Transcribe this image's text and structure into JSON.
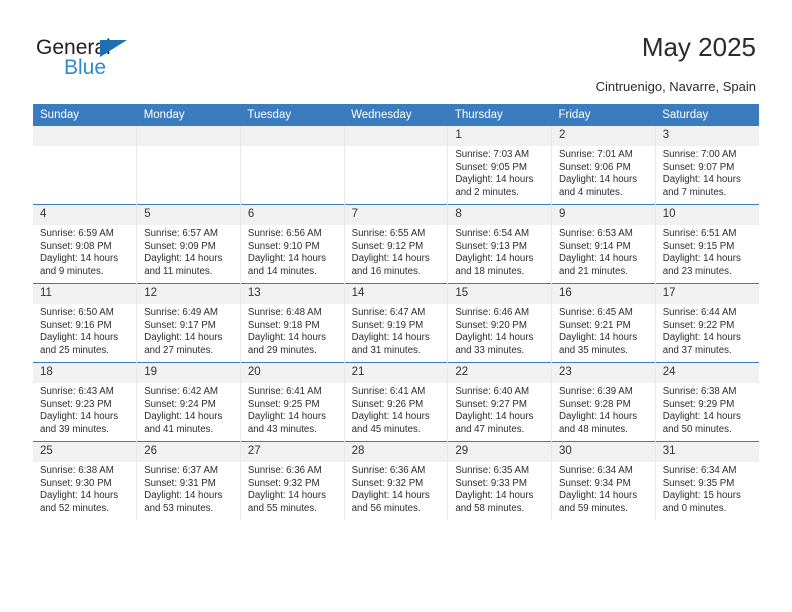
{
  "brand": {
    "name_top": "General",
    "name_bottom": "Blue",
    "triangle_color": "#1c6fb4",
    "blue_color": "#2e8bd0"
  },
  "header": {
    "title": "May 2025",
    "subtitle": "Cintruenigo, Navarre, Spain"
  },
  "theme": {
    "header_blue": "#3b7cbf",
    "daynum_band": "#f1f1f1",
    "text": "#2d2d2d"
  },
  "calendar": {
    "weekday_headers": [
      "Sunday",
      "Monday",
      "Tuesday",
      "Wednesday",
      "Thursday",
      "Friday",
      "Saturday"
    ],
    "weeks": [
      [
        {
          "day": "",
          "lines": []
        },
        {
          "day": "",
          "lines": []
        },
        {
          "day": "",
          "lines": []
        },
        {
          "day": "",
          "lines": []
        },
        {
          "day": "1",
          "lines": [
            "Sunrise: 7:03 AM",
            "Sunset: 9:05 PM",
            "Daylight: 14 hours",
            "and 2 minutes."
          ]
        },
        {
          "day": "2",
          "lines": [
            "Sunrise: 7:01 AM",
            "Sunset: 9:06 PM",
            "Daylight: 14 hours",
            "and 4 minutes."
          ]
        },
        {
          "day": "3",
          "lines": [
            "Sunrise: 7:00 AM",
            "Sunset: 9:07 PM",
            "Daylight: 14 hours",
            "and 7 minutes."
          ]
        }
      ],
      [
        {
          "day": "4",
          "lines": [
            "Sunrise: 6:59 AM",
            "Sunset: 9:08 PM",
            "Daylight: 14 hours",
            "and 9 minutes."
          ]
        },
        {
          "day": "5",
          "lines": [
            "Sunrise: 6:57 AM",
            "Sunset: 9:09 PM",
            "Daylight: 14 hours",
            "and 11 minutes."
          ]
        },
        {
          "day": "6",
          "lines": [
            "Sunrise: 6:56 AM",
            "Sunset: 9:10 PM",
            "Daylight: 14 hours",
            "and 14 minutes."
          ]
        },
        {
          "day": "7",
          "lines": [
            "Sunrise: 6:55 AM",
            "Sunset: 9:12 PM",
            "Daylight: 14 hours",
            "and 16 minutes."
          ]
        },
        {
          "day": "8",
          "lines": [
            "Sunrise: 6:54 AM",
            "Sunset: 9:13 PM",
            "Daylight: 14 hours",
            "and 18 minutes."
          ]
        },
        {
          "day": "9",
          "lines": [
            "Sunrise: 6:53 AM",
            "Sunset: 9:14 PM",
            "Daylight: 14 hours",
            "and 21 minutes."
          ]
        },
        {
          "day": "10",
          "lines": [
            "Sunrise: 6:51 AM",
            "Sunset: 9:15 PM",
            "Daylight: 14 hours",
            "and 23 minutes."
          ]
        }
      ],
      [
        {
          "day": "11",
          "lines": [
            "Sunrise: 6:50 AM",
            "Sunset: 9:16 PM",
            "Daylight: 14 hours",
            "and 25 minutes."
          ]
        },
        {
          "day": "12",
          "lines": [
            "Sunrise: 6:49 AM",
            "Sunset: 9:17 PM",
            "Daylight: 14 hours",
            "and 27 minutes."
          ]
        },
        {
          "day": "13",
          "lines": [
            "Sunrise: 6:48 AM",
            "Sunset: 9:18 PM",
            "Daylight: 14 hours",
            "and 29 minutes."
          ]
        },
        {
          "day": "14",
          "lines": [
            "Sunrise: 6:47 AM",
            "Sunset: 9:19 PM",
            "Daylight: 14 hours",
            "and 31 minutes."
          ]
        },
        {
          "day": "15",
          "lines": [
            "Sunrise: 6:46 AM",
            "Sunset: 9:20 PM",
            "Daylight: 14 hours",
            "and 33 minutes."
          ]
        },
        {
          "day": "16",
          "lines": [
            "Sunrise: 6:45 AM",
            "Sunset: 9:21 PM",
            "Daylight: 14 hours",
            "and 35 minutes."
          ]
        },
        {
          "day": "17",
          "lines": [
            "Sunrise: 6:44 AM",
            "Sunset: 9:22 PM",
            "Daylight: 14 hours",
            "and 37 minutes."
          ]
        }
      ],
      [
        {
          "day": "18",
          "lines": [
            "Sunrise: 6:43 AM",
            "Sunset: 9:23 PM",
            "Daylight: 14 hours",
            "and 39 minutes."
          ]
        },
        {
          "day": "19",
          "lines": [
            "Sunrise: 6:42 AM",
            "Sunset: 9:24 PM",
            "Daylight: 14 hours",
            "and 41 minutes."
          ]
        },
        {
          "day": "20",
          "lines": [
            "Sunrise: 6:41 AM",
            "Sunset: 9:25 PM",
            "Daylight: 14 hours",
            "and 43 minutes."
          ]
        },
        {
          "day": "21",
          "lines": [
            "Sunrise: 6:41 AM",
            "Sunset: 9:26 PM",
            "Daylight: 14 hours",
            "and 45 minutes."
          ]
        },
        {
          "day": "22",
          "lines": [
            "Sunrise: 6:40 AM",
            "Sunset: 9:27 PM",
            "Daylight: 14 hours",
            "and 47 minutes."
          ]
        },
        {
          "day": "23",
          "lines": [
            "Sunrise: 6:39 AM",
            "Sunset: 9:28 PM",
            "Daylight: 14 hours",
            "and 48 minutes."
          ]
        },
        {
          "day": "24",
          "lines": [
            "Sunrise: 6:38 AM",
            "Sunset: 9:29 PM",
            "Daylight: 14 hours",
            "and 50 minutes."
          ]
        }
      ],
      [
        {
          "day": "25",
          "lines": [
            "Sunrise: 6:38 AM",
            "Sunset: 9:30 PM",
            "Daylight: 14 hours",
            "and 52 minutes."
          ]
        },
        {
          "day": "26",
          "lines": [
            "Sunrise: 6:37 AM",
            "Sunset: 9:31 PM",
            "Daylight: 14 hours",
            "and 53 minutes."
          ]
        },
        {
          "day": "27",
          "lines": [
            "Sunrise: 6:36 AM",
            "Sunset: 9:32 PM",
            "Daylight: 14 hours",
            "and 55 minutes."
          ]
        },
        {
          "day": "28",
          "lines": [
            "Sunrise: 6:36 AM",
            "Sunset: 9:32 PM",
            "Daylight: 14 hours",
            "and 56 minutes."
          ]
        },
        {
          "day": "29",
          "lines": [
            "Sunrise: 6:35 AM",
            "Sunset: 9:33 PM",
            "Daylight: 14 hours",
            "and 58 minutes."
          ]
        },
        {
          "day": "30",
          "lines": [
            "Sunrise: 6:34 AM",
            "Sunset: 9:34 PM",
            "Daylight: 14 hours",
            "and 59 minutes."
          ]
        },
        {
          "day": "31",
          "lines": [
            "Sunrise: 6:34 AM",
            "Sunset: 9:35 PM",
            "Daylight: 15 hours",
            "and 0 minutes."
          ]
        }
      ]
    ]
  }
}
